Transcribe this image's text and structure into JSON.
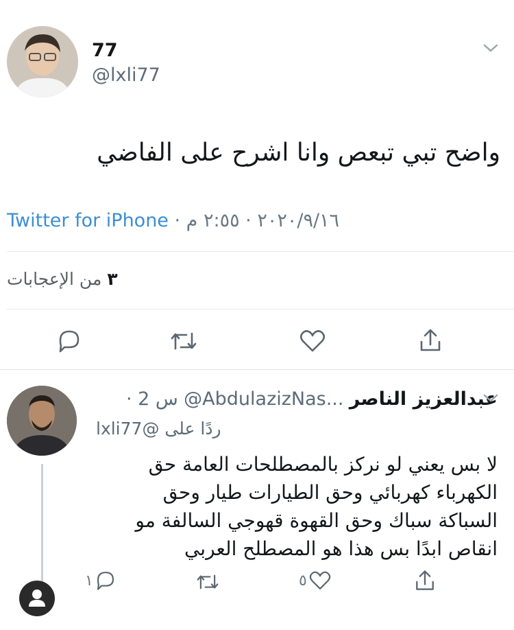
{
  "tweet": {
    "author_name": "77",
    "author_handle": "@lxli77",
    "text": "واضح تبي تبعص وانا اشرح على الفاضي",
    "source": "Twitter for iPhone",
    "meta_rest": " · ٢٠٢٠/٩/١٦ · ٢:٥٥ م",
    "likes_count": "٣",
    "likes_label": "من الإعجابات"
  },
  "reply": {
    "author_name": "عبدالعزيز الناصر",
    "author_handle": "@AbdulazizNas...",
    "time": "· 2 س",
    "replying_to": "ردًا على @lxli77",
    "lines": [
      "لا بس يعني لو نركز بالمصطلحات العامة حق",
      "الكهرباء كهربائي وحق الطيارات طيار وحق",
      "السباكة سباك وحق القهوة قهوجي السالفة مو",
      "انقاص ابدًا بس هذا هو المصطلح العربي"
    ],
    "reply_count": "١",
    "retweet_count": "",
    "like_count": "٥"
  },
  "icons": [
    "chevron-down-icon",
    "reply-icon",
    "retweet-icon",
    "like-icon",
    "share-icon",
    "profile-icon"
  ],
  "colors": {
    "link": "#3b8ed3",
    "muted": "#697884",
    "text": "#14171a"
  }
}
